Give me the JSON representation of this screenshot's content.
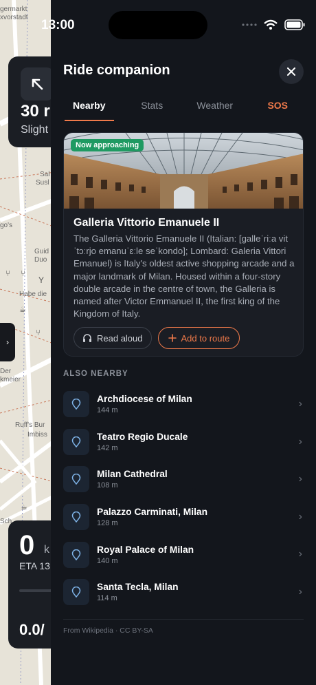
{
  "status_bar": {
    "time": "13:00"
  },
  "map": {
    "labels": [
      "germarkt",
      "xvorstadt",
      "Sal",
      "Susl",
      "go's",
      "Guid",
      "Duo",
      "Habe die",
      "Der",
      "kmeier",
      "Ruff's Bur",
      "Imbiss",
      "Sch"
    ],
    "nav": {
      "distance": "30 r",
      "direction": "Slight"
    },
    "trip": {
      "value": "0",
      "unit": "k",
      "eta": "ETA 13",
      "speed": "0.0/"
    }
  },
  "panel": {
    "title": "Ride companion",
    "tabs": [
      {
        "label": "Nearby",
        "active": true
      },
      {
        "label": "Stats"
      },
      {
        "label": "Weather"
      },
      {
        "label": "SOS"
      }
    ],
    "feature": {
      "badge": "Now approaching",
      "title": "Galleria Vittorio Emanuele II",
      "description": "The Galleria Vittorio Emanuele II (Italian: [galleˈriːa vitˈtɔːrjo emanuˈɛːle seˈkondo]; Lombard: Galeria Vittori Emanuel) is Italy's oldest active shopping arcade and a major landmark of Milan. Housed within a four-story double arcade in the centre of town, the Galleria is named after Victor Emmanuel II, the first king of the Kingdom of Italy.",
      "read_aloud": "Read aloud",
      "add_to_route": "Add to route"
    },
    "also_nearby_label": "ALSO NEARBY",
    "nearby": [
      {
        "name": "Archdiocese of Milan",
        "distance": "144 m"
      },
      {
        "name": "Teatro Regio Ducale",
        "distance": "142 m"
      },
      {
        "name": "Milan Cathedral",
        "distance": "108 m"
      },
      {
        "name": "Palazzo Carminati, Milan",
        "distance": "128 m"
      },
      {
        "name": "Royal Palace of Milan",
        "distance": "140 m"
      },
      {
        "name": "Santa Tecla, Milan",
        "distance": "114 m"
      }
    ],
    "footer": "From Wikipedia · CC BY-SA"
  },
  "colors": {
    "accent": "#f07a4a",
    "badge": "#1f9a62",
    "panel_bg": "#13161c"
  },
  "icons": [
    "arrow-up-left-icon",
    "chevron-right-icon",
    "close-icon",
    "headphones-icon",
    "plus-icon",
    "map-pin-icon",
    "wifi-icon",
    "battery-icon",
    "signal-icon"
  ]
}
